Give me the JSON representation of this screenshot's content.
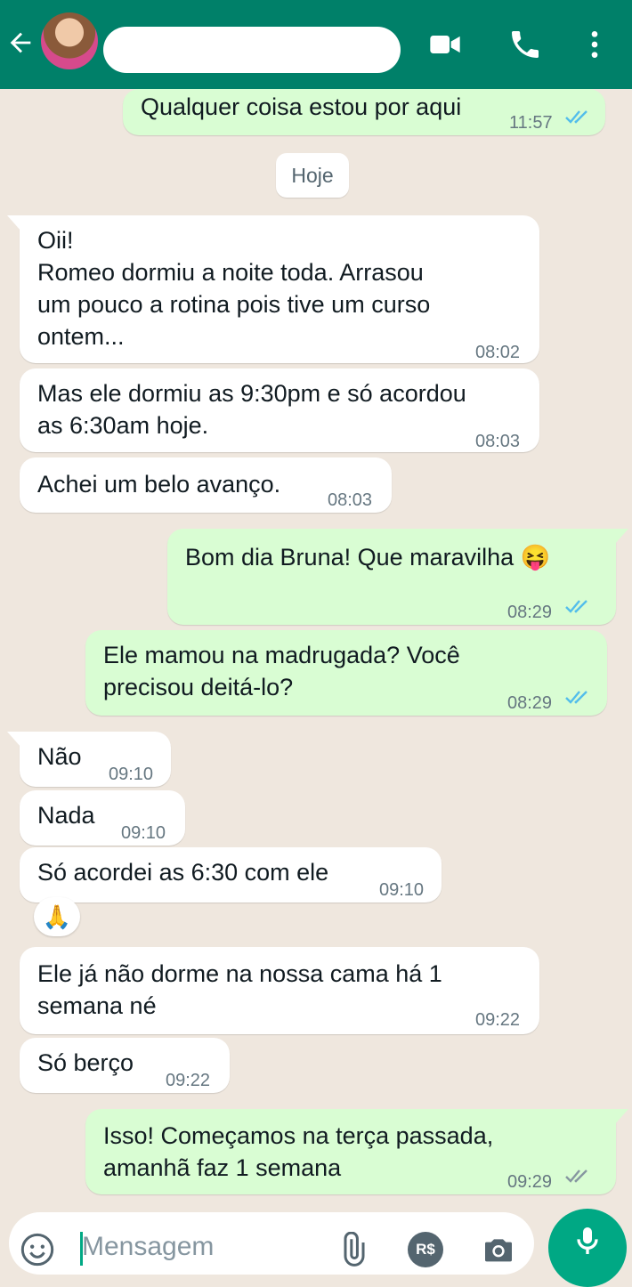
{
  "header": {
    "contact_name": "",
    "colors": {
      "bar": "#008069",
      "icon": "#ffffff"
    },
    "icons": [
      "back-arrow-icon",
      "video-call-icon",
      "voice-call-icon",
      "more-options-icon"
    ]
  },
  "chat": {
    "date_chip": "Hoje",
    "messages": [
      {
        "dir": "out",
        "text": "Qualquer coisa estou por aqui",
        "time": "11:57",
        "status": "read"
      },
      {
        "dir": "in",
        "text": "Oii!\nRomeo dormiu a noite toda. Arrasou\num pouco a rotina pois tive um curso\nontem...",
        "time": "08:02"
      },
      {
        "dir": "in",
        "text": "Mas ele dormiu as 9:30pm e só acordou\nas 6:30am hoje.",
        "time": "08:03"
      },
      {
        "dir": "in",
        "text": "Achei um belo avanço.",
        "time": "08:03"
      },
      {
        "dir": "out",
        "text": "Bom dia Bruna! Que maravilha 😝",
        "time": "08:29",
        "status": "read"
      },
      {
        "dir": "out",
        "text": "Ele mamou na madrugada? Você\nprecisou deitá-lo?",
        "time": "08:29",
        "status": "read"
      },
      {
        "dir": "in",
        "text": "Não",
        "time": "09:10"
      },
      {
        "dir": "in",
        "text": "Nada",
        "time": "09:10"
      },
      {
        "dir": "in",
        "text": "Só acordei as 6:30 com ele",
        "time": "09:10",
        "reaction": "🙏"
      },
      {
        "dir": "in",
        "text": "Ele já não dorme na nossa cama há 1\nsemana né",
        "time": "09:22"
      },
      {
        "dir": "in",
        "text": "Só berço",
        "time": "09:22"
      },
      {
        "dir": "out",
        "text": "Isso! Começamos na terça passada,\namanhã faz 1 semana",
        "time": "09:29",
        "status": "delivered"
      }
    ]
  },
  "composer": {
    "placeholder": "Mensagem",
    "icons": [
      "emoji-icon",
      "attach-icon",
      "payment-icon",
      "camera-icon",
      "mic-icon"
    ],
    "payment_label": "R$"
  },
  "colors": {
    "incoming_bubble": "#ffffff",
    "outgoing_bubble": "#d9fdd3",
    "read_ticks": "#53bdeb",
    "delivered_ticks": "#8696a0",
    "chat_background": "#efe7de"
  }
}
